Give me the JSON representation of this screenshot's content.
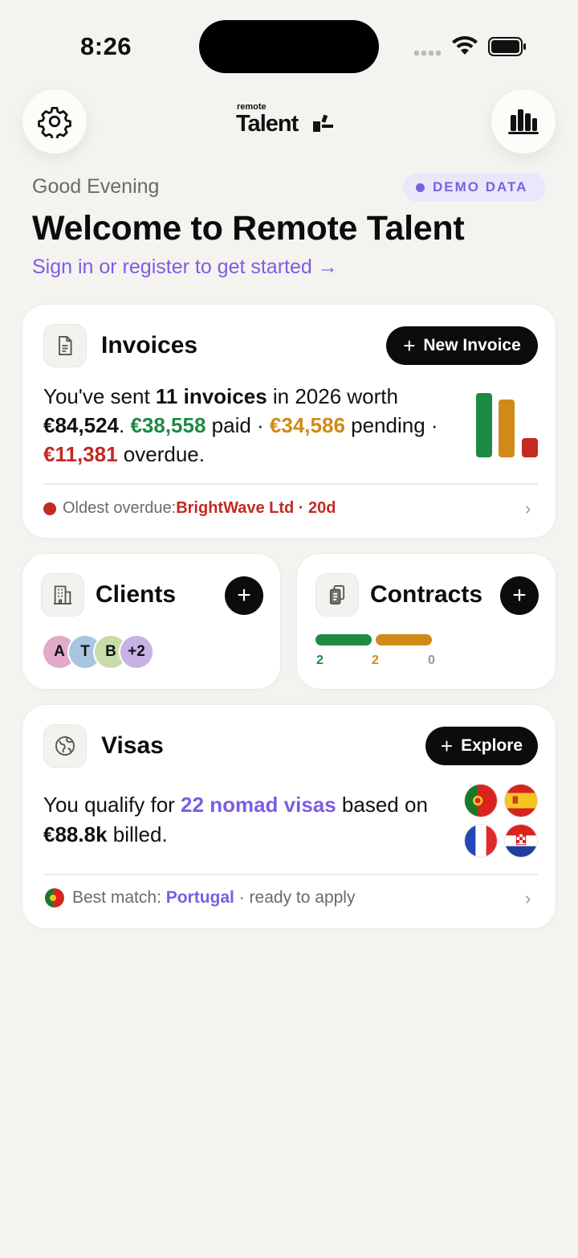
{
  "status": {
    "time": "8:26"
  },
  "header": {
    "logo_small": "remote",
    "logo_big": "Talent",
    "settings_icon": "gear-icon",
    "stats_icon": "bar-chart-icon"
  },
  "hero": {
    "greeting": "Good Evening",
    "badge": "DEMO DATA",
    "title": "Welcome to Remote Talent",
    "signin": "Sign in or register to get started →"
  },
  "colors": {
    "accent": "#7b5ee0",
    "paid": "#1e8a44",
    "pending": "#d18a17",
    "overdue": "#c22a22"
  },
  "invoices": {
    "title": "Invoices",
    "new_button": "New Invoice",
    "summary": {
      "t1": "You've sent ",
      "count": "11 invoices",
      "t2": " in 2026 worth ",
      "total": "€84,524",
      "t3": ". ",
      "paid": "€38,558",
      "t4": " paid · ",
      "pending": "€34,586",
      "t5": " pending · ",
      "overdue": "€11,381",
      "t6": " overdue."
    },
    "bars": {
      "paid": 38558,
      "pending": 34586,
      "overdue": 11381
    },
    "oldest_label": "Oldest overdue: ",
    "oldest_value": "BrightWave Ltd · 20d"
  },
  "clients": {
    "title": "Clients",
    "avatars": [
      "A",
      "T",
      "B",
      "+2"
    ]
  },
  "contracts": {
    "title": "Contracts",
    "counts": [
      "2",
      "2",
      "0"
    ]
  },
  "visas": {
    "title": "Visas",
    "explore_button": "Explore",
    "t1": "You qualify for ",
    "count": "22 nomad visas",
    "t2": " based on ",
    "amount": "€88.8k",
    "t3": " billed.",
    "best_label": "Best match: ",
    "best_country": "Portugal",
    "best_suffix": " · ready to apply",
    "flags": [
      "portugal-flag-icon",
      "spain-flag-icon",
      "france-flag-icon",
      "croatia-flag-icon"
    ]
  }
}
